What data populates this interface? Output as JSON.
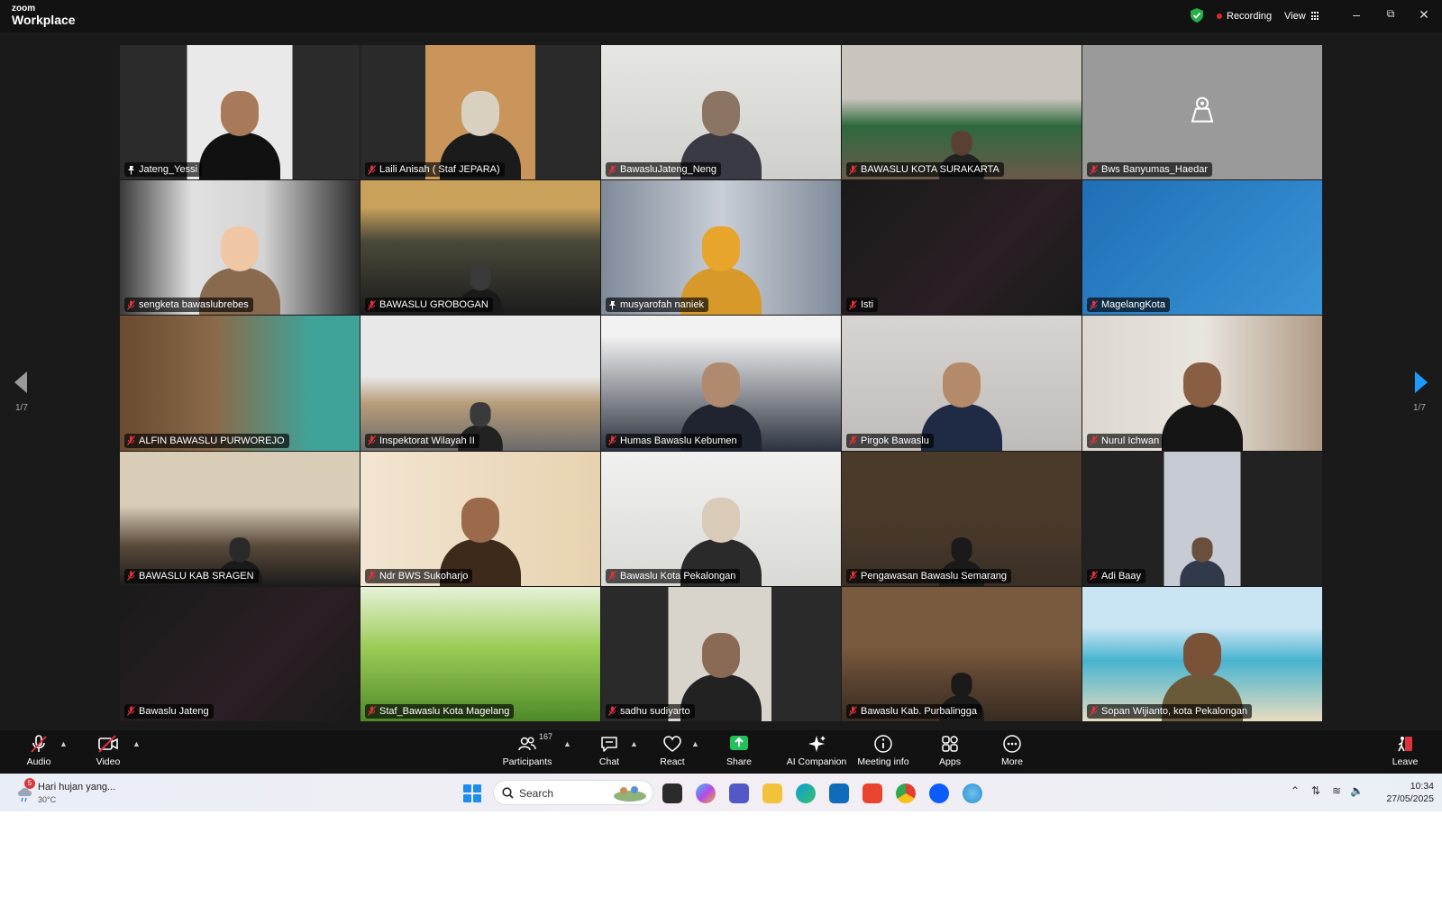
{
  "app": {
    "logo_top": "zoom",
    "logo_bottom": "Workplace",
    "recording_label": "Recording",
    "view_label": "View",
    "colors": {
      "active_speaker": "#2ecc71",
      "recording_dot": "#e02828",
      "share_green": "#21c15c",
      "nav_arrow": "#1a9bff"
    }
  },
  "navigation": {
    "prev_page_label": "1/7",
    "next_page_label": "1/7"
  },
  "participants": [
    {
      "name": "Jateng_Yessi",
      "muted": false,
      "active": true,
      "scene": "presenter"
    },
    {
      "name": "Laili Anisah ( Staf JEPARA)",
      "muted": true,
      "scene": "portrait-hijab"
    },
    {
      "name": "BawasluJateng_Neng",
      "muted": true,
      "scene": "office-hijab"
    },
    {
      "name": "BAWASLU KOTA SURAKARTA",
      "muted": true,
      "scene": "meeting-room"
    },
    {
      "name": "Bws Banyumas_Haedar",
      "muted": true,
      "scene": "camera-off"
    },
    {
      "name": "sengketa bawaslubrebes",
      "muted": true,
      "scene": "avatar"
    },
    {
      "name": "BAWASLU GROBOGAN",
      "muted": true,
      "scene": "room-dark"
    },
    {
      "name": "musyarofah naniek",
      "muted": false,
      "scene": "yellow-hijab"
    },
    {
      "name": "Isti",
      "muted": true,
      "scene": "dark"
    },
    {
      "name": "MagelangKota",
      "muted": true,
      "scene": "hr-background"
    },
    {
      "name": "ALFIN BAWASLU PURWOREJO",
      "muted": true,
      "scene": "blur"
    },
    {
      "name": "Inspektorat Wilayah II",
      "muted": true,
      "scene": "office-room"
    },
    {
      "name": "Humas Bawaslu Kebumen",
      "muted": true,
      "scene": "man-phone"
    },
    {
      "name": "Pirgok Bawaslu",
      "muted": true,
      "scene": "man-glasses"
    },
    {
      "name": "Nurul Ichwan",
      "muted": true,
      "scene": "man-chair"
    },
    {
      "name": "BAWASLU KAB SRAGEN",
      "muted": true,
      "scene": "hall"
    },
    {
      "name": "Ndr BWS Sukoharjo",
      "muted": true,
      "scene": "batik-man"
    },
    {
      "name": "Bawaslu Kota Pekalongan",
      "muted": true,
      "scene": "hijab-white"
    },
    {
      "name": "Pengawasan Bawaslu Semarang",
      "muted": true,
      "scene": "bawaslu-panel"
    },
    {
      "name": "Adi Baay",
      "muted": true,
      "scene": "car"
    },
    {
      "name": "Bawaslu Jateng",
      "muted": true,
      "scene": "dark"
    },
    {
      "name": "Staf_Bawaslu Kota Magelang",
      "muted": true,
      "scene": "grass"
    },
    {
      "name": "sadhu sudiyarto",
      "muted": true,
      "scene": "man-narrow"
    },
    {
      "name": "Bawaslu Kab. Purbalingga",
      "muted": true,
      "scene": "panel-room"
    },
    {
      "name": "Sopan Wijianto, kota Pekalongan",
      "muted": true,
      "scene": "beach"
    }
  ],
  "toolbar": {
    "audio": "Audio",
    "video": "Video",
    "participants": "Participants",
    "participants_count": "167",
    "chat": "Chat",
    "react": "React",
    "share": "Share",
    "ai_companion": "AI Companion",
    "meeting_info": "Meeting info",
    "apps": "Apps",
    "more": "More",
    "leave": "Leave"
  },
  "taskbar": {
    "weather_text": "Hari hujan yang...",
    "weather_temp": "30°C",
    "weather_badge": "5",
    "search_placeholder": "Search",
    "time": "10:34",
    "date": "27/05/2025"
  }
}
